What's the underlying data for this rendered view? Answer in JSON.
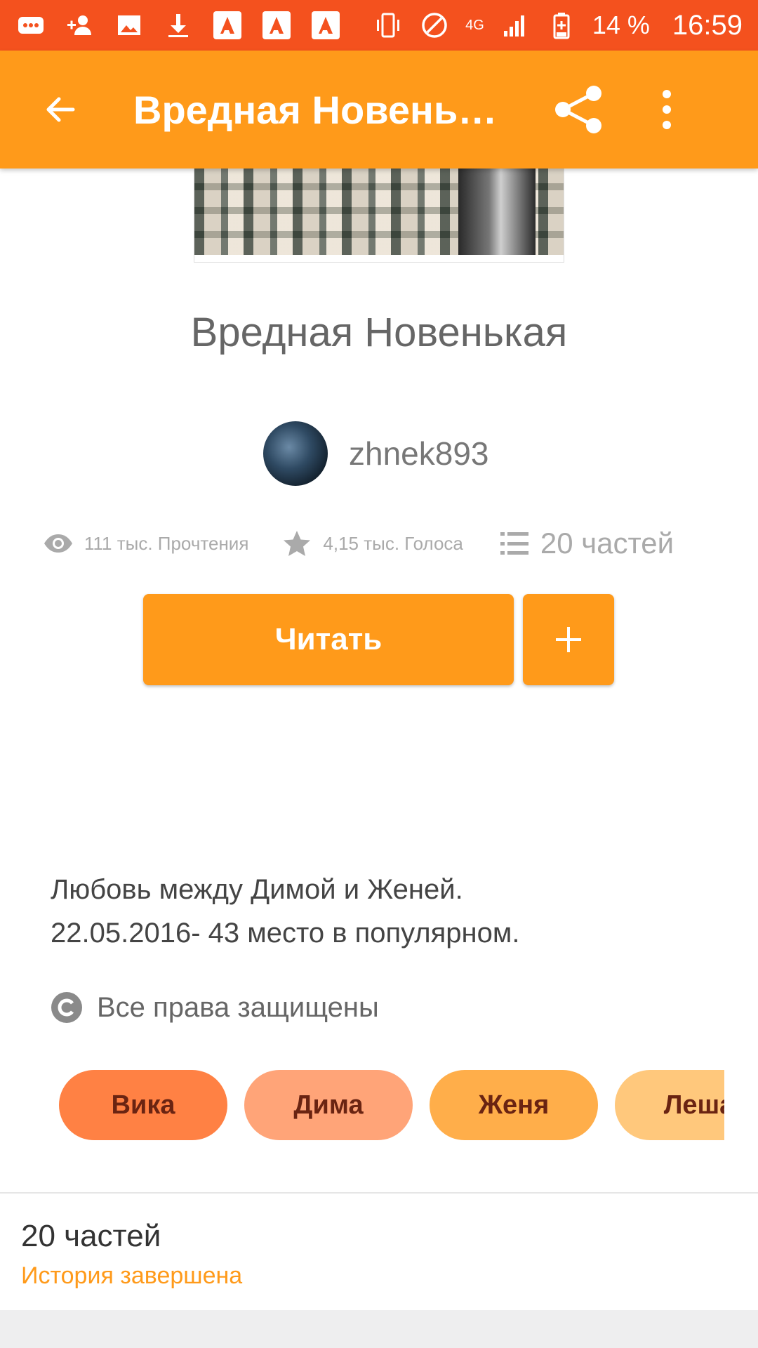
{
  "status_bar": {
    "battery": "14 %",
    "time": "16:59",
    "network": "4G",
    "icons": [
      "message-icon",
      "add-person-icon",
      "image-icon",
      "download-icon",
      "app-a-icon",
      "app-a-icon",
      "app-a-icon",
      "vibrate-icon",
      "no-disturb-icon",
      "signal-icon",
      "battery-icon"
    ]
  },
  "app_bar": {
    "title": "Вредная Новеньк...",
    "back_icon": "back-arrow-icon",
    "share_icon": "share-icon",
    "more_icon": "more-vert-icon"
  },
  "story": {
    "title": "Вредная Новенькая",
    "author": "zhnek893",
    "reads": "111 тыс. Прочтения",
    "votes": "4,15 тыс. Голоса",
    "parts": "20 частей",
    "description_line1": "Любовь между Димой и Женей.",
    "description_line2": "22.05.2016- 43 место в популярном.",
    "copyright": "Все права защищены"
  },
  "actions": {
    "read_label": "Читать",
    "add_label": "+"
  },
  "tags": [
    {
      "label": "Вика",
      "color": "#ff8144"
    },
    {
      "label": "Дима",
      "color": "#ffa478"
    },
    {
      "label": "Женя",
      "color": "#ffae4a"
    },
    {
      "label": "Леша",
      "color": "#ffc87c"
    }
  ],
  "toc": {
    "parts_count": "20 частей",
    "status": "История завершена"
  },
  "colors": {
    "status_bar": "#f4511e",
    "accent": "#ff9a1a",
    "text_muted": "#aaaaaa"
  }
}
